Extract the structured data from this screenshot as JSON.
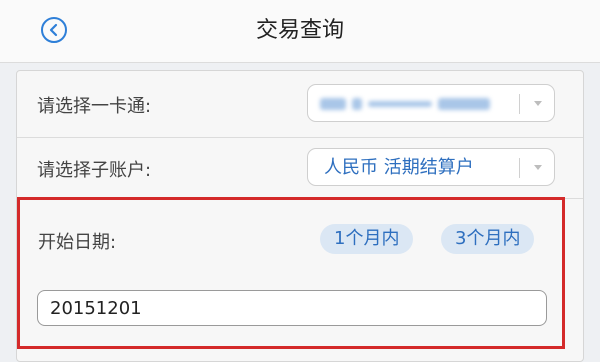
{
  "nav": {
    "title": "交易查询",
    "back_icon": "chevron-left-circle-icon"
  },
  "form": {
    "card_label": "请选择一卡通:",
    "card_value_obscured": true,
    "subaccount_label": "请选择子账户:",
    "subaccount_value": "人民币 活期结算户",
    "start_date_label": "开始日期:",
    "quick_ranges": [
      "1个月内",
      "3个月内"
    ],
    "start_date_value": "20151201"
  },
  "colors": {
    "accent": "#2e6fbf",
    "highlight": "#d42a2a",
    "pill_bg": "#dbe7f4"
  }
}
